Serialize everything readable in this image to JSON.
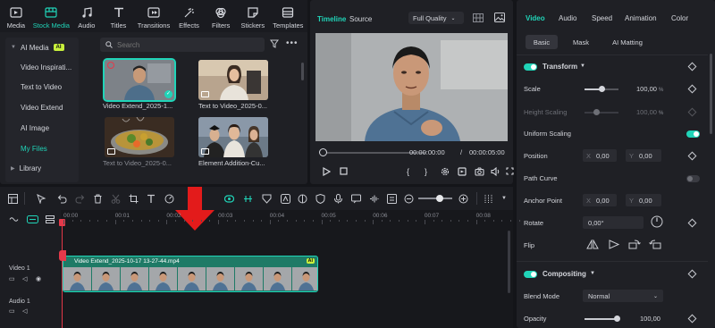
{
  "media_tabs": [
    {
      "label": "Media",
      "icon": "media-icon"
    },
    {
      "label": "Stock Media",
      "icon": "stock-media-icon",
      "active": true
    },
    {
      "label": "Audio",
      "icon": "music-note-icon"
    },
    {
      "label": "Titles",
      "icon": "titles-icon"
    },
    {
      "label": "Transitions",
      "icon": "transitions-icon"
    },
    {
      "label": "Effects",
      "icon": "effects-icon"
    },
    {
      "label": "Filters",
      "icon": "filters-icon"
    },
    {
      "label": "Stickers",
      "icon": "stickers-icon"
    },
    {
      "label": "Templates",
      "icon": "templates-icon"
    }
  ],
  "sidebar": {
    "header": "AI Media",
    "header_badge": "AI",
    "items": [
      "Video Inspirati...",
      "Text to Video",
      "Video Extend",
      "AI Image",
      "My Files",
      "Library"
    ],
    "active_item": "My Files"
  },
  "search": {
    "placeholder": "Search"
  },
  "thumbnails": [
    {
      "label": "Video Extend_2025-1...",
      "selected": true
    },
    {
      "label": "Text to Video_2025-0..."
    },
    {
      "label": "Text to Video_2025-0..."
    },
    {
      "label": "Element Addition-Cu..."
    }
  ],
  "player": {
    "tab_timeline": "Timeline",
    "tab_source": "Source",
    "quality": "Full Quality",
    "time_current": "00:00:00:00",
    "time_separator": "/",
    "time_total": "00:00:05:00"
  },
  "properties": {
    "tabs": [
      "Video",
      "Audio",
      "Speed",
      "Animation",
      "Color"
    ],
    "active_tab": "Video",
    "subtabs": [
      "Basic",
      "Mask",
      "AI Matting"
    ],
    "active_subtab": "Basic",
    "transform_title": "Transform",
    "scale_label": "Scale",
    "scale_value": "100,00",
    "scale_unit": "%",
    "height_scaling_label": "Height Scaling",
    "height_scaling_value": "100,00",
    "height_scaling_unit": "%",
    "uniform_scaling_label": "Uniform Scaling",
    "position_label": "Position",
    "position_x_axis": "X",
    "position_x": "0,00",
    "position_y_axis": "Y",
    "position_y": "0,00",
    "path_curve_label": "Path Curve",
    "anchor_label": "Anchor Point",
    "anchor_x_axis": "X",
    "anchor_x": "0,00",
    "anchor_y_axis": "Y",
    "anchor_y": "0,00",
    "rotate_label": "Rotate",
    "rotate_value": "0,00°",
    "flip_label": "Flip",
    "compositing_title": "Compositing",
    "blend_label": "Blend Mode",
    "blend_value": "Normal",
    "opacity_label": "Opacity",
    "opacity_value": "100,00",
    "scale_level": 0.5,
    "opacity_level": 1.0
  },
  "ruler": [
    "00:00",
    "00:01",
    "00:02",
    "00:03",
    "00:04",
    "00:05",
    "00:06",
    "00:07",
    "00:08"
  ],
  "tracks": {
    "video_label": "Video 1",
    "audio_label": "Audio 1"
  },
  "clip": {
    "title": "Video Extend_2025-10-17 13-27-44.mp4",
    "badge": "AI"
  },
  "colors": {
    "accent": "#20d4b8",
    "playhead": "#e5394a",
    "clip": "#1e7a66",
    "ai_badge": "#c8f03c"
  }
}
